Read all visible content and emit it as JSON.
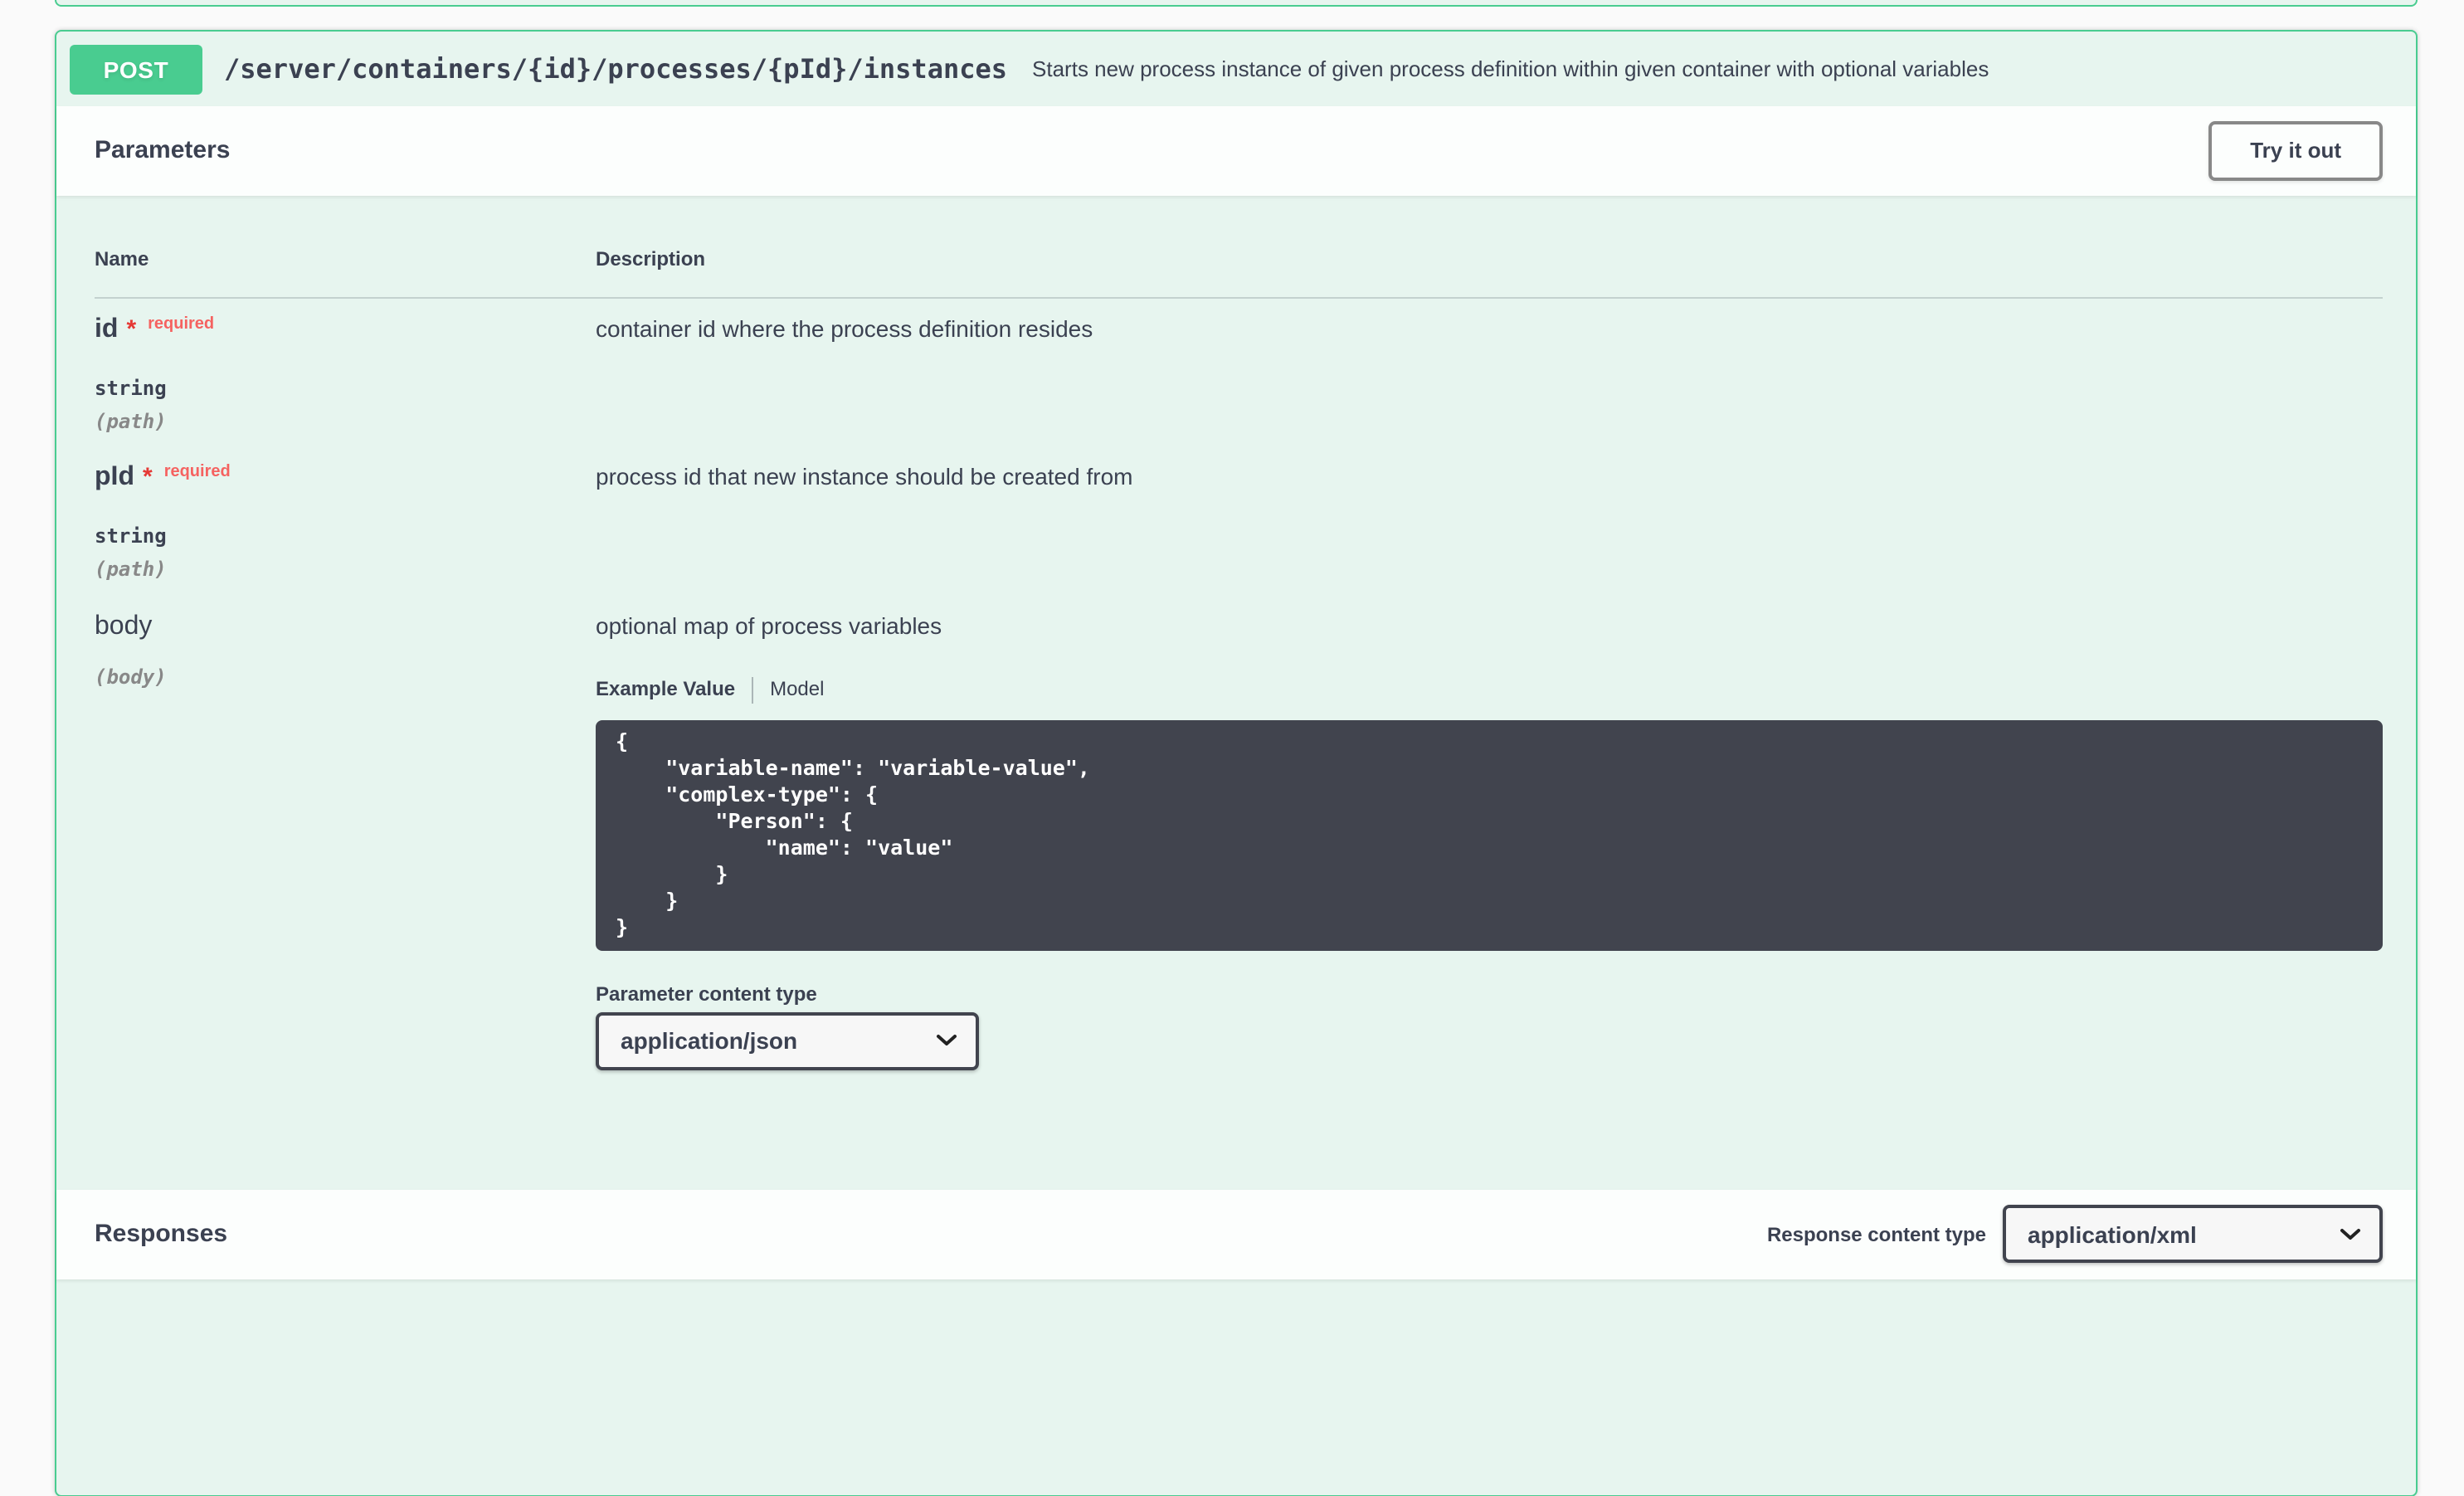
{
  "endpoint": {
    "method": "POST",
    "path": "/server/containers/{id}/processes/{pId}/instances",
    "summary": "Starts new process instance of given process definition within given container with optional variables"
  },
  "parameters": {
    "section_title": "Parameters",
    "try_it_out": "Try it out",
    "col_name": "Name",
    "col_description": "Description",
    "required_marker": "*",
    "rows": [
      {
        "name": "id",
        "required": "required",
        "type": "string",
        "location": "(path)",
        "description": "container id where the process definition resides"
      },
      {
        "name": "pId",
        "required": "required",
        "type": "string",
        "location": "(path)",
        "description": "process id that new instance should be created from"
      },
      {
        "name": "body",
        "location": "(body)",
        "description": "optional map of process variables"
      }
    ],
    "body_editor": {
      "tab_example": "Example Value",
      "tab_model": "Model",
      "example_json": "{\n    \"variable-name\": \"variable-value\",\n    \"complex-type\": {\n        \"Person\": {\n            \"name\": \"value\"\n        }\n    }\n}",
      "content_type_label": "Parameter content type",
      "content_type": "application/json"
    }
  },
  "responses": {
    "section_title": "Responses",
    "content_type_label": "Response content type",
    "content_type": "application/xml"
  },
  "colors": {
    "accent_green": "#49cc90",
    "text": "#3b4151",
    "required_red": "#e53935",
    "code_background": "#41444e",
    "page_background": "#fafafa"
  }
}
